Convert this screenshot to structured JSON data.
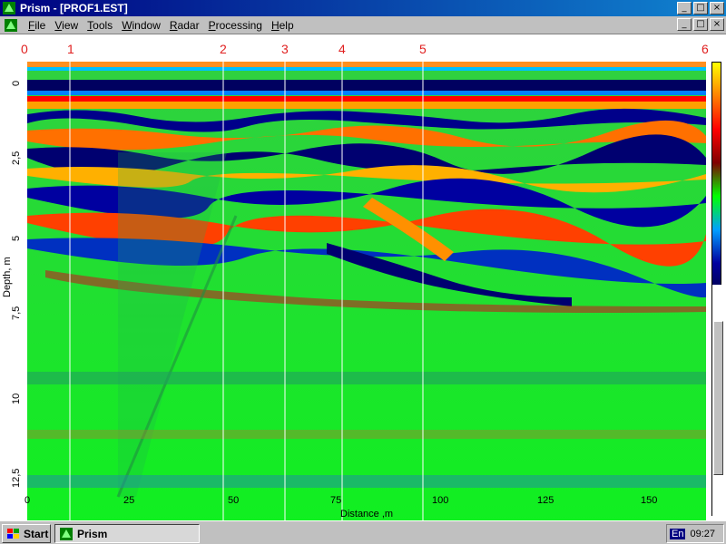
{
  "window": {
    "title": "Prism - [PROF1.EST]",
    "controls": [
      "_",
      "□",
      "×"
    ]
  },
  "menu": [
    {
      "label": "File"
    },
    {
      "label": "View"
    },
    {
      "label": "Tools"
    },
    {
      "label": "Window"
    },
    {
      "label": "Radar"
    },
    {
      "label": "Processing"
    },
    {
      "label": "Help"
    }
  ],
  "mdi_controls": [
    "_",
    "□",
    "×"
  ],
  "radargram": {
    "markers": [
      "0",
      "1",
      "2",
      "3",
      "4",
      "5",
      "6"
    ],
    "depth_ticks": [
      "0",
      "2,5",
      "5",
      "7,5",
      "10",
      "12,5"
    ],
    "distance_ticks": [
      "0",
      "25",
      "50",
      "75",
      "100",
      "125",
      "150"
    ],
    "ylabel": "Depth, m",
    "xlabel": "Distance ,m"
  },
  "taskbar": {
    "start_label": "Start",
    "task_label": "Prism",
    "lang": "En",
    "clock": "09:27"
  },
  "colors": {
    "title_bar": "#000080",
    "marker": "#e02020",
    "background_green": "#00e000"
  }
}
